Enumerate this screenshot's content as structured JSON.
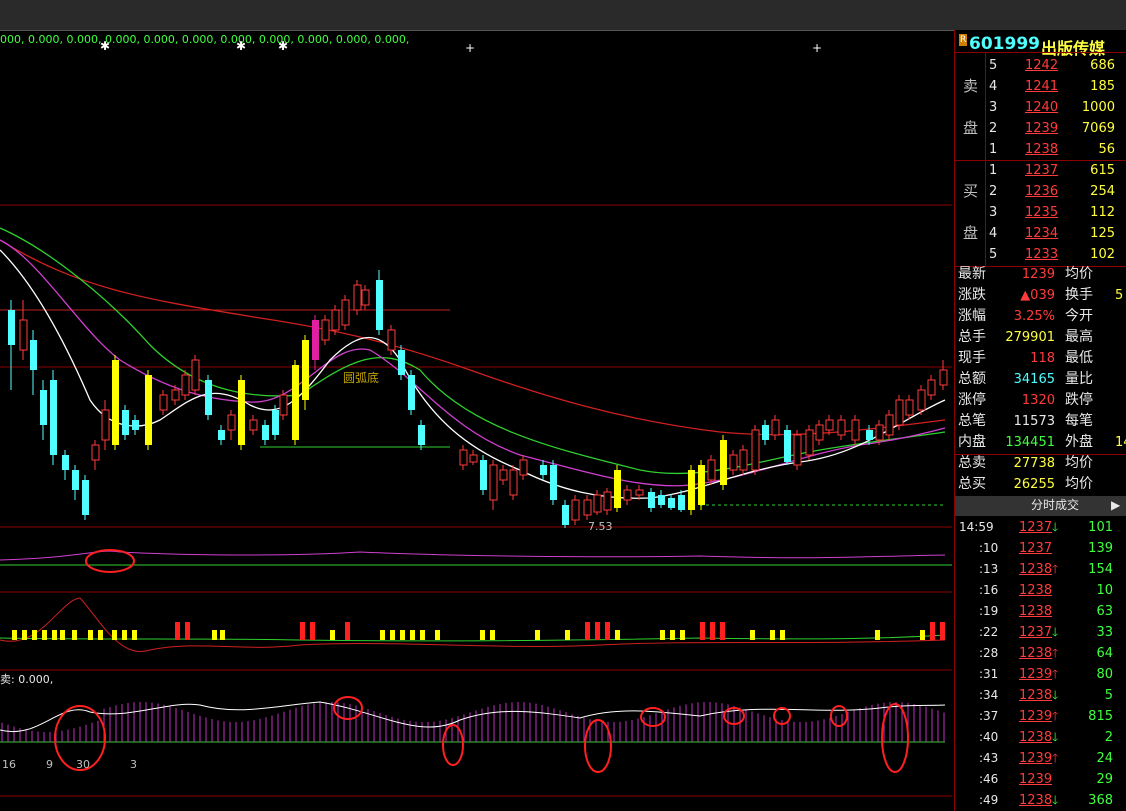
{
  "indicator_top": "000, 0.000, 0.000, 0.000, 0.000, 0.000, 0.000, 0.000, 0.000, 0.000, 0.000,",
  "indicator_bottom": "卖: 0.000,",
  "chart_labels": {
    "pattern_1": "圆弧底",
    "low_price": "7.53",
    "lower_axis": [
      "16",
      "9",
      "30",
      "3"
    ]
  },
  "stock": {
    "badge": "R",
    "code": "601999",
    "name": "出版传媒"
  },
  "order_book": {
    "sell_label": [
      "卖",
      "盘"
    ],
    "buy_label": [
      "买",
      "盘"
    ],
    "sells": [
      {
        "level": "5",
        "price": "1242",
        "vol": "686"
      },
      {
        "level": "4",
        "price": "1241",
        "vol": "185"
      },
      {
        "level": "3",
        "price": "1240",
        "vol": "1000"
      },
      {
        "level": "2",
        "price": "1239",
        "vol": "7069"
      },
      {
        "level": "1",
        "price": "1238",
        "vol": "56"
      }
    ],
    "buys": [
      {
        "level": "1",
        "price": "1237",
        "vol": "615"
      },
      {
        "level": "2",
        "price": "1236",
        "vol": "254"
      },
      {
        "level": "3",
        "price": "1235",
        "vol": "112"
      },
      {
        "level": "4",
        "price": "1234",
        "vol": "125"
      },
      {
        "level": "5",
        "price": "1233",
        "vol": "102"
      }
    ]
  },
  "quote": [
    {
      "label": "最新",
      "value": "1239",
      "label2": "均价",
      "value2": ""
    },
    {
      "label": "涨跌",
      "value": "▲039",
      "label2": "换手",
      "value2": "5"
    },
    {
      "label": "涨幅",
      "value": "3.25%",
      "label2": "今开",
      "value2": ""
    },
    {
      "label": "总手",
      "value": "279901",
      "label2": "最高",
      "value2": ""
    },
    {
      "label": "现手",
      "value": "118",
      "label2": "最低",
      "value2": ""
    },
    {
      "label": "总额",
      "value": "34165",
      "label2": "量比",
      "value2": ""
    },
    {
      "label": "涨停",
      "value": "1320",
      "label2": "跌停",
      "value2": ""
    },
    {
      "label": "总笔",
      "value": "11573",
      "label2": "每笔",
      "value2": ""
    },
    {
      "label": "内盘",
      "value": "134451",
      "label2": "外盘",
      "value2": "14"
    },
    {
      "label": "总卖",
      "value": "27738",
      "label2": "均价",
      "value2": ""
    },
    {
      "label": "总买",
      "value": "26255",
      "label2": "均价",
      "value2": ""
    }
  ],
  "tape_title": "分时成交",
  "tape_arrow": "▶",
  "tape": [
    {
      "time": "14:59",
      "price": "1237",
      "dir": "down",
      "vol": "101"
    },
    {
      "time": ":10",
      "price": "1237",
      "dir": "",
      "vol": "139"
    },
    {
      "time": ":13",
      "price": "1238",
      "dir": "up",
      "vol": "154"
    },
    {
      "time": ":16",
      "price": "1238",
      "dir": "",
      "vol": "10"
    },
    {
      "time": ":19",
      "price": "1238",
      "dir": "",
      "vol": "63"
    },
    {
      "time": ":22",
      "price": "1237",
      "dir": "down",
      "vol": "33"
    },
    {
      "time": ":28",
      "price": "1238",
      "dir": "up",
      "vol": "64"
    },
    {
      "time": ":31",
      "price": "1239",
      "dir": "up",
      "vol": "80"
    },
    {
      "time": ":34",
      "price": "1238",
      "dir": "down",
      "vol": "5"
    },
    {
      "time": ":37",
      "price": "1239",
      "dir": "up",
      "vol": "815"
    },
    {
      "time": ":40",
      "price": "1238",
      "dir": "down",
      "vol": "2"
    },
    {
      "time": ":43",
      "price": "1239",
      "dir": "up",
      "vol": "24"
    },
    {
      "time": ":46",
      "price": "1239",
      "dir": "",
      "vol": "29"
    },
    {
      "time": ":49",
      "price": "1238",
      "dir": "down",
      "vol": "368"
    }
  ],
  "colors": {
    "up": "#ff3b3b",
    "down": "#4fffff",
    "ma_white": "#ffffff",
    "ma_green": "#2fd02f",
    "ma_magenta": "#d040d0",
    "ma_red": "#d02020"
  }
}
